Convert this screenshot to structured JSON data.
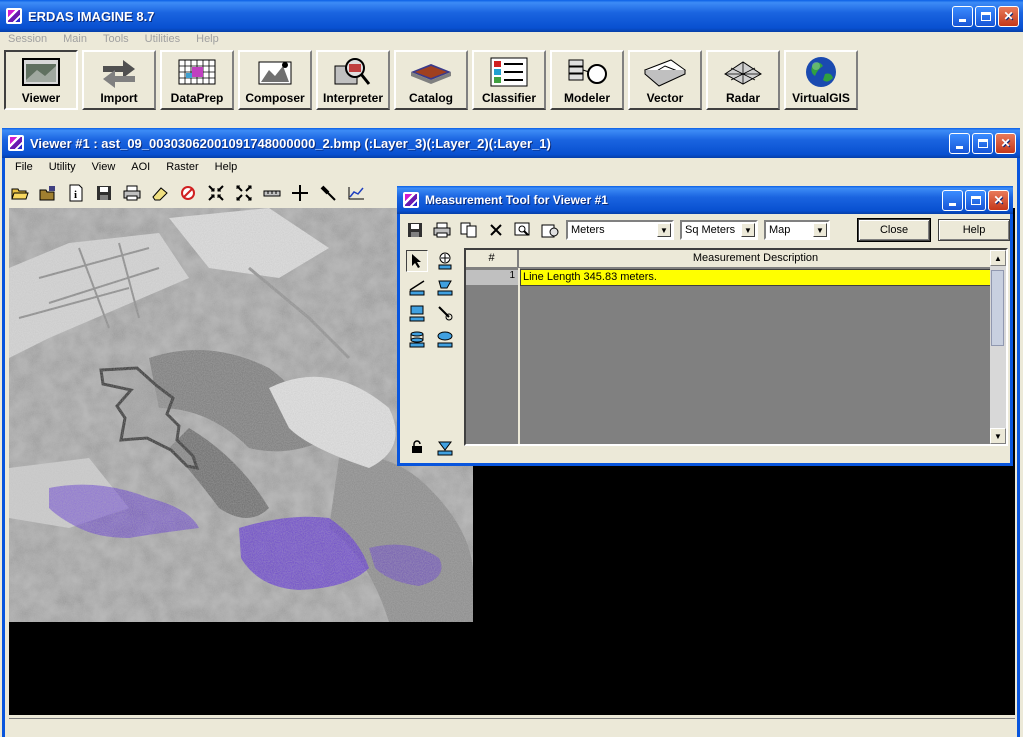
{
  "app": {
    "title": "ERDAS IMAGINE 8.7",
    "menu": [
      "Session",
      "Main",
      "Tools",
      "Utilities",
      "Help"
    ],
    "tools": [
      {
        "label": "Viewer",
        "icon": "viewer-icon"
      },
      {
        "label": "Import",
        "icon": "import-icon"
      },
      {
        "label": "DataPrep",
        "icon": "dataprep-icon"
      },
      {
        "label": "Composer",
        "icon": "composer-icon"
      },
      {
        "label": "Interpreter",
        "icon": "interpreter-icon"
      },
      {
        "label": "Catalog",
        "icon": "catalog-icon"
      },
      {
        "label": "Classifier",
        "icon": "classifier-icon"
      },
      {
        "label": "Modeler",
        "icon": "modeler-icon"
      },
      {
        "label": "Vector",
        "icon": "vector-icon"
      },
      {
        "label": "Radar",
        "icon": "radar-icon"
      },
      {
        "label": "VirtualGIS",
        "icon": "globe-icon"
      }
    ]
  },
  "viewer": {
    "title": "Viewer #1 : ast_09_00303062001091748000000_2.bmp (:Layer_3)(:Layer_2)(:Layer_1)",
    "menu": [
      "File",
      "Utility",
      "View",
      "AOI",
      "Raster",
      "Help"
    ],
    "toolbar_icons": [
      "open-folder-icon",
      "open-layer-icon",
      "info-icon",
      "save-icon",
      "print-icon",
      "eraser-icon",
      "no-entry-icon",
      "zoom-in-icon",
      "zoom-out-icon",
      "measure-ruler-icon",
      "crosshair-icon",
      "hammer-icon",
      "graph-icon"
    ]
  },
  "measure": {
    "title": "Measurement Tool for Viewer #1",
    "unit_length": "Meters",
    "unit_area": "Sq Meters",
    "coord": "Map",
    "close_label": "Close",
    "help_label": "Help",
    "col_num": "#",
    "col_desc": "Measurement Description",
    "rows": [
      {
        "num": "1",
        "desc": "Line Length 345.83 meters."
      }
    ]
  },
  "colors": {
    "xp_title": "#0a5fe6",
    "highlight_row": "#ffff00",
    "aoi_overlay": "#5a2ad8"
  }
}
